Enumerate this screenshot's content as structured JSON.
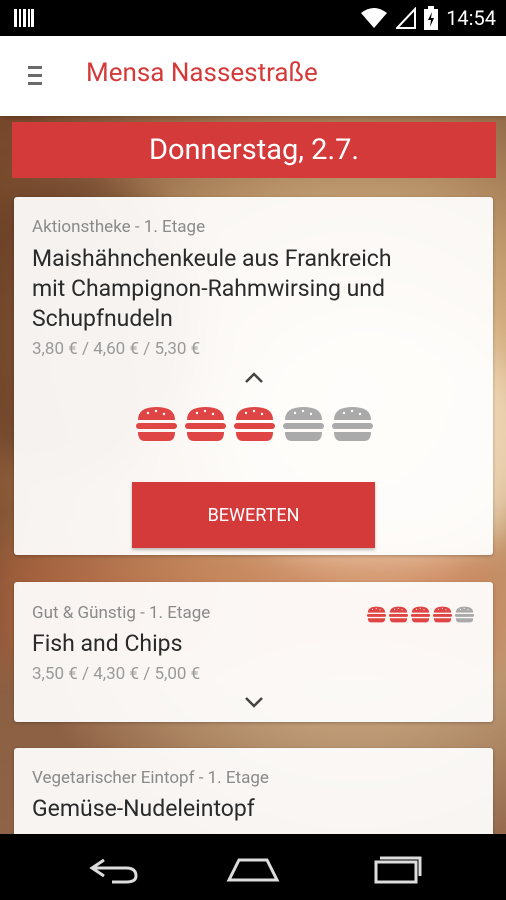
{
  "status_bar": {
    "time": "14:54",
    "icons": [
      "barcode-icon",
      "wifi-icon",
      "cell-signal-icon",
      "battery-charging-icon"
    ]
  },
  "app_bar": {
    "menu_icon": "hamburger-menu-icon",
    "title": "Mensa Nassestraße"
  },
  "date_banner": "Donnerstag, 2.7.",
  "meals": [
    {
      "category": "Aktionstheke - 1. Etage",
      "title_lines": [
        "Maishähnchenkeule aus Frankreich",
        "mit Champignon-Rahmwirsing und",
        "Schupfnudeln"
      ],
      "prices": "3,80 € / 4,60 € / 5,30 €",
      "expanded": true,
      "rating": 3,
      "rating_max": 5,
      "rate_button": "BEWERTEN"
    },
    {
      "category": "Gut & Günstig - 1. Etage",
      "title_lines": [
        "Fish and Chips"
      ],
      "prices": "3,50 € / 4,30 € / 5,00 €",
      "expanded": false,
      "rating": 4,
      "rating_max": 5
    },
    {
      "category": "Vegetarischer Eintopf - 1. Etage",
      "title_lines": [
        "Gemüse-Nudeleintopf"
      ]
    }
  ],
  "colors": {
    "accent": "#d43a3a",
    "burger_active": "#e04545",
    "burger_inactive": "#aaaaaa",
    "text_primary": "#2a2a2a",
    "text_secondary": "#8a8a8a"
  },
  "nav_bar": [
    "back-icon",
    "home-icon",
    "recents-icon"
  ]
}
